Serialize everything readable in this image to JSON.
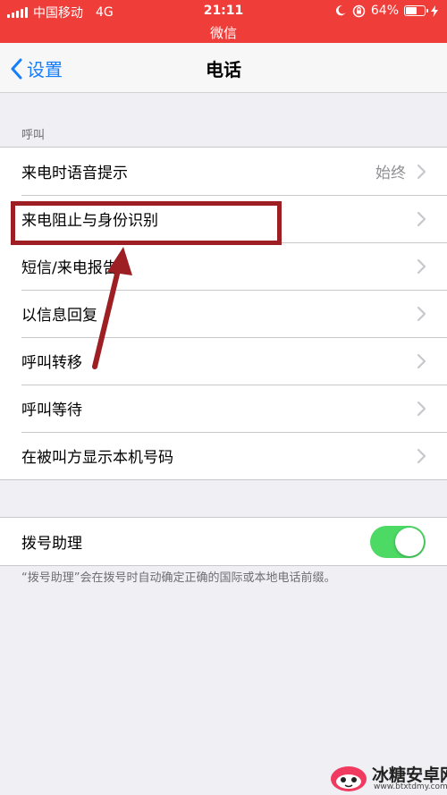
{
  "status_bar": {
    "carrier": "中国移动",
    "network": "4G",
    "time": "21:11",
    "battery_percent_text": "64%",
    "battery_level": 0.64,
    "subtitle": "微信",
    "background_color": "#ef3e3a"
  },
  "nav": {
    "back_label": "设置",
    "title": "电话",
    "accent_color": "#157efb"
  },
  "sections": {
    "calls": {
      "header": "呼叫",
      "items": [
        {
          "label": "来电时语音提示",
          "value": "始终"
        },
        {
          "label": "来电阻止与身份识别"
        },
        {
          "label": "短信/来电报告"
        },
        {
          "label": "以信息回复"
        },
        {
          "label": "呼叫转移"
        },
        {
          "label": "呼叫等待"
        },
        {
          "label": "在被叫方显示本机号码"
        }
      ]
    },
    "dial_assist": {
      "label": "拨号助理",
      "enabled": true,
      "toggle_color": "#4cd964",
      "footer": "“拨号助理”会在拨号时自动确定正确的国际或本地电话前缀。"
    }
  },
  "annotation": {
    "color": "#9d1f24"
  },
  "watermark": {
    "name": "冰糖安卓网",
    "url": "www.btxtdmy.com"
  }
}
